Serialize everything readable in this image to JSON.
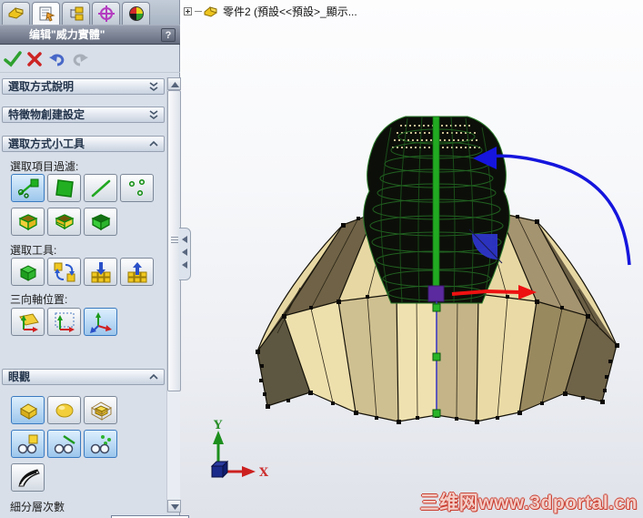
{
  "panel": {
    "tabs": [
      {
        "name": "feature-manager-tab",
        "icon": "yellow-part-icon",
        "selected": false
      },
      {
        "name": "property-manager-tab",
        "icon": "property-sheet-hand-icon",
        "selected": true
      },
      {
        "name": "configuration-manager-tab",
        "icon": "configurations-tree-icon",
        "selected": false
      },
      {
        "name": "dimxpert-tab",
        "icon": "magenta-target-icon",
        "selected": false
      },
      {
        "name": "display-manager-tab",
        "icon": "color-sphere-icon",
        "selected": false
      }
    ],
    "title": "编辑\"威力實體\"",
    "help": "?",
    "toolbar": [
      {
        "name": "ok-button",
        "icon": "green-check-icon"
      },
      {
        "name": "cancel-button",
        "icon": "red-x-icon"
      },
      {
        "name": "undo-button",
        "icon": "blue-undo-arrow-icon"
      },
      {
        "name": "redo-button",
        "icon": "gray-redo-arrow-icon",
        "disabled": true
      }
    ],
    "sections": {
      "selection_help": {
        "label": "選取方式說明",
        "collapsed": true
      },
      "feature_settings": {
        "label": "特徵物創建設定",
        "collapsed": true
      },
      "selection_tools": {
        "label": "選取方式小工具",
        "collapsed": false
      },
      "view": {
        "label": "眼觀",
        "collapsed": false
      }
    },
    "labels": {
      "filter": "選取項目過濾:",
      "tools": "選取工具:",
      "triad": "三向軸位置:",
      "subdivision": "細分層次數"
    },
    "buttons": {
      "filter_row": [
        "filter-all-button (selected)",
        "filter-faces-button",
        "filter-edges-button",
        "filter-vertices-button"
      ],
      "box_row": [
        "select-open-box-button",
        "select-half-box-button",
        "select-green-box-button"
      ],
      "tools_row": [
        "select-volume-button",
        "swap-selection-button",
        "grow-selection-button",
        "shrink-selection-button"
      ],
      "triad_row": [
        "triad-on-plane-button",
        "triad-bounding-button",
        "triad-free-button (selected)"
      ],
      "view_row1": [
        "show-solid-button (selected)",
        "show-smooth-button",
        "show-cage-button"
      ],
      "view_row2": [
        "show-faces-button (selected)",
        "show-edges-button (selected)",
        "show-vertices-button (selected)"
      ],
      "view_row3": [
        "zebra-stripes-button"
      ]
    }
  },
  "viewport": {
    "tree_item": "零件2 (預設<<預設>_顯示...",
    "watermark": "三维网www.3dportal.cn",
    "axis": {
      "x": "X",
      "y": "Y"
    }
  },
  "colors": {
    "selection_blue": "#9cc6ec",
    "panel_bg": "#d8dfe9",
    "titlebar_dark": "#636b7d",
    "mesh_tan": "#e7d8a3",
    "mesh_dark": "#5d5741",
    "dome_black": "#0c0f09",
    "wire_green": "#2e7d2e",
    "manip_green": "#22aa22",
    "manip_red": "#ee1111",
    "manip_blue": "#1515dd",
    "manip_purple": "#5b2a9e",
    "watermark_red": "#c93c2f"
  }
}
